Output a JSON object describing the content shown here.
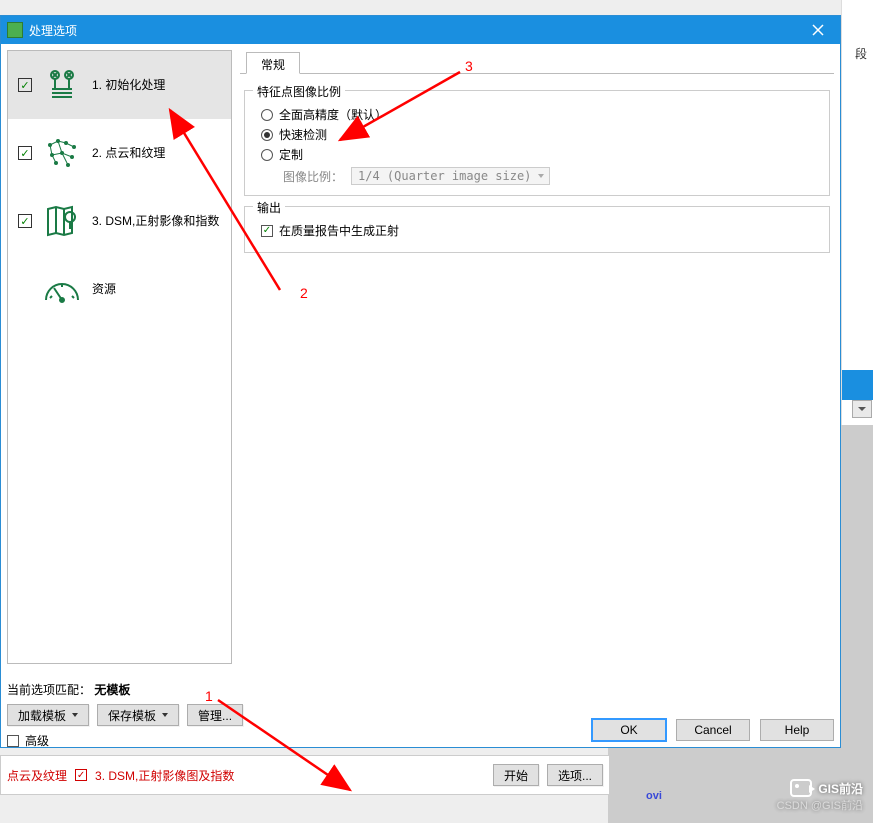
{
  "dialog": {
    "title": "处理选项",
    "close_tooltip": "关闭"
  },
  "sidebar": {
    "items": [
      {
        "label": "1. 初始化处理",
        "checked": true,
        "selected": true,
        "icon": "pistons-icon"
      },
      {
        "label": "2. 点云和纹理",
        "checked": true,
        "selected": false,
        "icon": "pointcloud-icon"
      },
      {
        "label": "3. DSM,正射影像和指数",
        "checked": true,
        "selected": false,
        "icon": "map-pin-icon"
      },
      {
        "label": "资源",
        "checked": null,
        "selected": false,
        "icon": "gauge-icon"
      }
    ]
  },
  "tabs": {
    "active": "常规"
  },
  "group_featurescale": {
    "title": "特征点图像比例",
    "options": [
      {
        "label": "全面高精度（默认）",
        "selected": false
      },
      {
        "label": "快速检测",
        "selected": true
      },
      {
        "label": "定制",
        "selected": false
      }
    ],
    "image_scale_label": "图像比例：",
    "image_scale_value": "1/4 (Quarter image size)"
  },
  "group_output": {
    "title": "输出",
    "checkbox_label": "在质量报告中生成正射",
    "checkbox_checked": true
  },
  "footer": {
    "match_prefix": "当前选项匹配：",
    "match_value": "无模板",
    "load_template": "加载模板",
    "save_template": "保存模板",
    "manage": "管理...",
    "advanced": "高级",
    "advanced_checked": false,
    "ok": "OK",
    "cancel": "Cancel",
    "help": "Help"
  },
  "background": {
    "right_label": "段",
    "ovi_text": "ovi"
  },
  "bottom_strip": {
    "text1": "点云及纹理",
    "text2": "3. DSM,正射影像图及指数",
    "start": "开始",
    "options": "选项..."
  },
  "annotations": {
    "n1": "1",
    "n2": "2",
    "n3": "3"
  },
  "watermark": {
    "main": "GIS前沿",
    "sub": "CSDN @GIS前沿"
  }
}
